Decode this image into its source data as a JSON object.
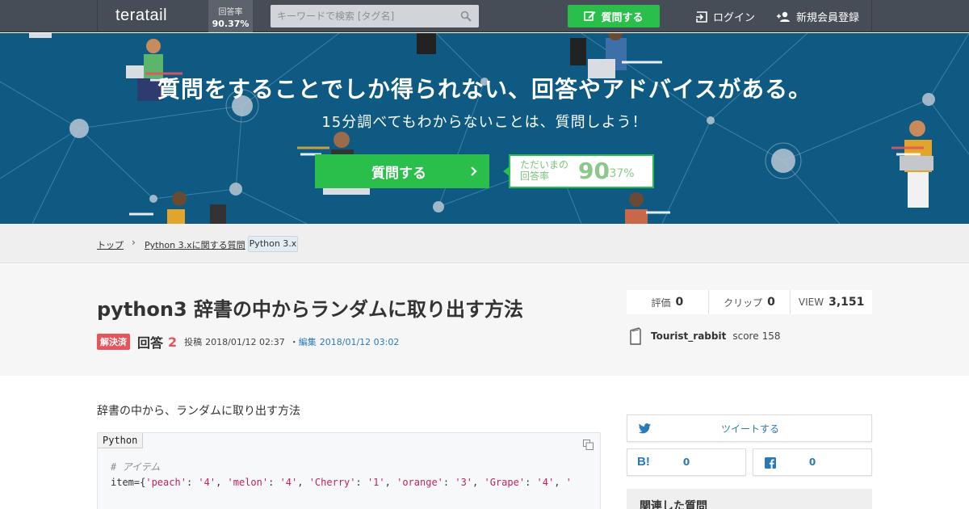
{
  "header": {
    "logo": "teratail",
    "rate_label": "回答率",
    "rate_value": "90.37%",
    "search_placeholder": "キーワードで検索 [タグ名]",
    "ask_button": "質問する",
    "login": "ログイン",
    "signup": "新規会員登録"
  },
  "hero": {
    "title": "質問をすることでしか得られない、回答やアドバイスがある。",
    "subtitle": "15分調べてもわからないことは、質問しよう！",
    "ask_button": "質問する",
    "rate_label_line1": "ただいまの",
    "rate_label_line2": "回答率",
    "rate_integer": "90",
    "rate_decimal": ".37%"
  },
  "breadcrumb": {
    "top": "トップ",
    "separator": "›",
    "category": "Python 3.xに関する質問",
    "tag": "Python 3.x"
  },
  "question": {
    "title": "python3 辞書の中からランダムに取り出す方法",
    "solved_badge": "解決済",
    "answers_label": "回答",
    "answers_count": "2",
    "posted_label": "投稿",
    "posted_date": "2018/01/12 02:37",
    "dot": "・",
    "edit_label": "編集",
    "edit_date": "2018/01/12 03:02",
    "body": "辞書の中から、ランダムに取り出す方法"
  },
  "stats": {
    "rating_label": "評価",
    "rating_value": "0",
    "clip_label": "クリップ",
    "clip_value": "0",
    "view_label": "VIEW",
    "view_value": "3,151"
  },
  "author": {
    "name": "Tourist_rabbit",
    "score_label": "score",
    "score_value": "158"
  },
  "code": {
    "language": "Python",
    "comment": "# アイテム",
    "line2": [
      {
        "t": "item={",
        "c": "plain"
      },
      {
        "t": "'peach'",
        "c": "str"
      },
      {
        "t": ": ",
        "c": "plain"
      },
      {
        "t": "'4'",
        "c": "str"
      },
      {
        "t": ", ",
        "c": "plain"
      },
      {
        "t": "'melon'",
        "c": "str"
      },
      {
        "t": ": ",
        "c": "plain"
      },
      {
        "t": "'4'",
        "c": "str"
      },
      {
        "t": ", ",
        "c": "plain"
      },
      {
        "t": "'Cherry'",
        "c": "str"
      },
      {
        "t": ": ",
        "c": "plain"
      },
      {
        "t": "'1'",
        "c": "str"
      },
      {
        "t": ", ",
        "c": "plain"
      },
      {
        "t": "'orange'",
        "c": "str"
      },
      {
        "t": ": ",
        "c": "plain"
      },
      {
        "t": "'3'",
        "c": "str"
      },
      {
        "t": ", ",
        "c": "plain"
      },
      {
        "t": "'Grape'",
        "c": "str"
      },
      {
        "t": ": ",
        "c": "plain"
      },
      {
        "t": "'4'",
        "c": "str"
      },
      {
        "t": ", ",
        "c": "plain"
      },
      {
        "t": "'",
        "c": "str"
      }
    ]
  },
  "sidebar": {
    "tweet": "ツイートする",
    "hatena_count": "0",
    "facebook_count": "0",
    "related_title": "関連した質問"
  },
  "colors": {
    "header_bg": "#474d56",
    "hero_bg": "#0e5a82",
    "accent_green": "#2abf4a",
    "solved_red": "#e7545c",
    "link_blue": "#2a7ab8"
  }
}
